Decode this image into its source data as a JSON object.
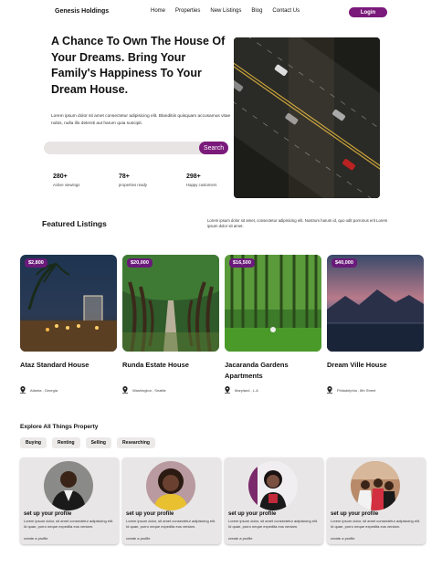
{
  "nav": {
    "brand": "Genesis Holdings",
    "links": [
      "Home",
      "Properties",
      "New Listings",
      "Blog",
      "Contact Us"
    ],
    "login": "Login"
  },
  "hero": {
    "title": "A Chance To Own The House Of Your Dreams. Bring Your Family's Happiness To Your Dream House.",
    "text": "Lorem ipsum dolor sit amet consectetur adipisicing elit. Blanditiis quisquam accusamus vitae nobis, nulla illo deleniti aut harum quia suscipit.",
    "search_placeholder": "",
    "search_button": "Search",
    "stats": [
      {
        "value": "280+",
        "label": "Active viewings"
      },
      {
        "value": "78+",
        "label": "properties ready"
      },
      {
        "value": "298+",
        "label": "Happy customers"
      }
    ]
  },
  "featured": {
    "title": "Featured Listings",
    "desc": "Lorem ipsum dolor sit amet, consectetur adipisicing elit. Nostrum harum id, quo odit porronus erit Lorem ipsum dolor sit amet.",
    "listings": [
      {
        "price": "$2,800",
        "title": "Ataz Standard House",
        "location": "Atlanta , Georgia"
      },
      {
        "price": "$20,000",
        "title": "Runda Estate House",
        "location": "Washington , Seattle"
      },
      {
        "price": "$16,500",
        "title": "Jacaranda Gardens Apartments",
        "location": "Maryland , L.A"
      },
      {
        "price": "$40,000",
        "title": "Dream Ville House",
        "location": "Philadelphia , 8th Street"
      }
    ]
  },
  "explore": {
    "title": "Explore All Things Property",
    "chips": [
      "Buying",
      "Renting",
      "Selling",
      "Researching"
    ],
    "profiles": [
      {
        "title": "set up your profile",
        "desc": "Lorem ipsum dolor, sit amet consectetur adipisicing elit. Id quae, porro neque expedita eos veniam.",
        "link": "create a profile"
      },
      {
        "title": "set up your profile",
        "desc": "Lorem ipsum dolor, sit amet consectetur adipisicing elit. Id quae, porro neque expedita eos veniam.",
        "link": "create a profile"
      },
      {
        "title": "set up your profile",
        "desc": "Lorem ipsum dolor, sit amet consectetur adipisicing elit. Id quae, porro neque expedita eos veniam.",
        "link": "create a profile"
      },
      {
        "title": "set up your profile",
        "desc": "Lorem ipsum dolor, sit amet consectetur adipisicing elit. Id quae, porro neque expedita eos veniam.",
        "link": "create a profile"
      }
    ]
  },
  "colors": {
    "accent": "#7a1a7a",
    "chip_bg": "#ece9e9",
    "card_bg": "#e8e6e6"
  },
  "icons": [
    "location-pin-icon"
  ]
}
